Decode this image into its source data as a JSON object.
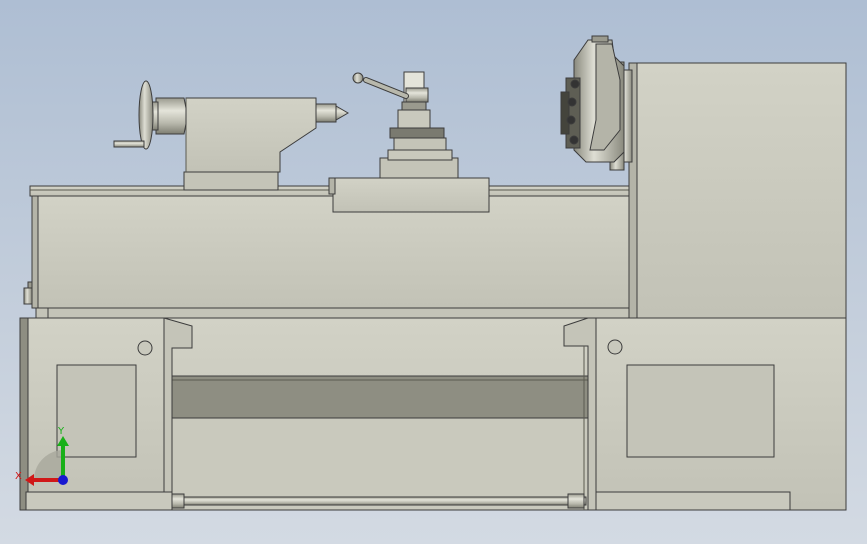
{
  "viewport": {
    "background_top": "#aebed3",
    "background_bottom": "#d3dae3"
  },
  "model": {
    "body_color": "#c9c9bd",
    "shade_color": "#a3a396",
    "dark_color": "#8e8e82",
    "edge_color": "#3c3c3c"
  },
  "triad": {
    "x_label": "X",
    "y_label": "Y",
    "x_color": "#d01818",
    "y_color": "#18b018",
    "z_color": "#1818d0"
  }
}
